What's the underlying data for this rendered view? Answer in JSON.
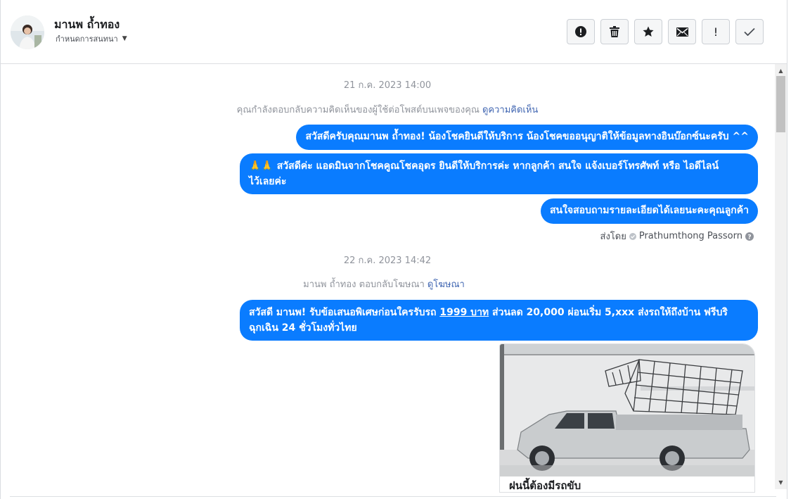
{
  "header": {
    "contact_name": "มานพ ถ้ำทอง",
    "assign_label": "กำหนดการสนทนา",
    "toolbar": [
      {
        "name": "spam-button",
        "icon": "alert-circle-icon"
      },
      {
        "name": "delete-button",
        "icon": "trash-icon"
      },
      {
        "name": "star-button",
        "icon": "star-icon"
      },
      {
        "name": "mark-unread-button",
        "icon": "envelope-icon"
      },
      {
        "name": "follow-up-button",
        "icon": "exclamation-icon",
        "glyph": "!"
      },
      {
        "name": "mark-done-button",
        "icon": "checkmark-icon",
        "glyph": "✓"
      }
    ]
  },
  "thread": {
    "date1": "21 ก.ค. 2023 14:00",
    "sys1_text": "คุณกำลังตอบกลับความคิดเห็นของผู้ใช้ต่อโพสต์บนเพจของคุณ",
    "sys1_link": "ดูความคิดเห็น",
    "msg1": "สวัสดีครับคุณมานพ ถ้ำทอง! น้องโชคยินดีให้บริการ น้องโชคขออนุญาติให้ข้อมูลทางอินบ๊อกซ์นะครับ ^^",
    "msg2_emoji": "🙏🙏",
    "msg2_line1": "สวัสดีค่ะ แอดมินจากโชคคูณโชคอุดร ยินดีให้บริการค่ะ หากลูกค้า สนใจ แจ้งเบอร์โทรศัพท์ หรือ ไอดีไลน์",
    "msg2_line2": "ไว้เลยค่ะ",
    "msg3": "สนใจสอบถามรายละเอียดได้เลยนะคะคุณลูกค้า",
    "sent_by_label": "ส่งโดย",
    "sent_by_name": "Prathumthong Passorn",
    "date2": "22 ก.ค. 2023 14:42",
    "sys2_text": "มานพ ถ้ำทอง ตอบกลับโฆษณา",
    "sys2_link": "ดูโฆษณา",
    "msg4_part1": "สวัสดี มานพ! รับข้อเสนอพิเศษก่อนใครรับรถ ",
    "msg4_underlined": "1999 บาท",
    "msg4_part2": " ส่วนลด 20,000  ผ่อนเริ่ม 5,xxx ส่งรถให้ถึงบ้าน ฟรีบริ",
    "msg4_line2": "ฉุกเฉิน 24 ชั่วโมงทั่วไทย",
    "ad_caption": "ฝนนี้ต้องมีรถขับ"
  },
  "colors": {
    "bubble": "#0a7cff",
    "link": "#4267b2",
    "muted": "#90949c"
  }
}
